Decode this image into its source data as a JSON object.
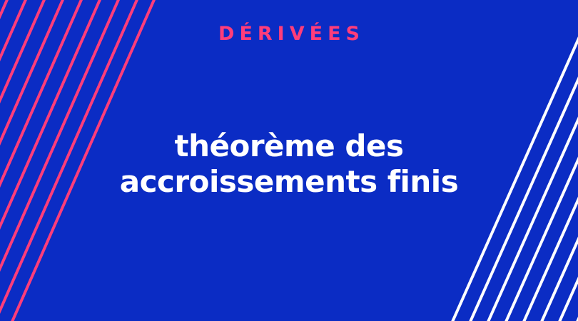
{
  "category": "DÉRIVÉES",
  "title_line1": "théorème des",
  "title_line2": "accroissements finis",
  "colors": {
    "background": "#0b2cc4",
    "accent": "#ff3d7a",
    "title": "#ffffff",
    "right_lines": "#ffffff",
    "left_lines": "#ff3d7a"
  }
}
